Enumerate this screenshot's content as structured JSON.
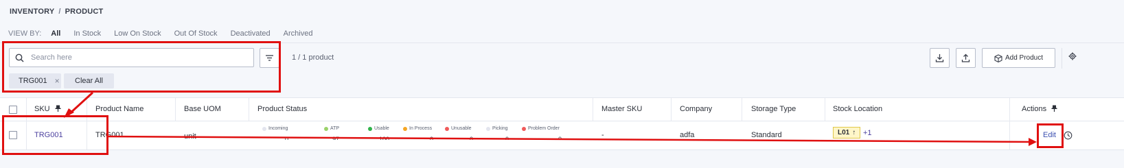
{
  "breadcrumb": {
    "parent": "INVENTORY",
    "separator": "/",
    "current": "PRODUCT"
  },
  "view_by": {
    "label": "VIEW BY:",
    "tabs": [
      "All",
      "In Stock",
      "Low On Stock",
      "Out Of Stock",
      "Deactivated",
      "Archived"
    ],
    "active": "All"
  },
  "search": {
    "placeholder": "Search here",
    "value": ""
  },
  "result_count": "1 / 1 product",
  "filters": {
    "chip": "TRG001",
    "chip_remove": "×",
    "clear_all": "Clear All"
  },
  "toolbar": {
    "add_product": "Add Product"
  },
  "table": {
    "columns": [
      "SKU",
      "Product Name",
      "Base UOM",
      "Product Status",
      "Master SKU",
      "Company",
      "Storage Type",
      "Stock Location",
      "Actions"
    ],
    "statuses": [
      {
        "label": "Incoming",
        "color": "#e3e5ee",
        "value": "0"
      },
      {
        "label": "ATP",
        "color": "#9bd26a",
        "value": "97"
      },
      {
        "label": "Usable",
        "color": "#2fb34a",
        "value": "100"
      },
      {
        "label": "In Process",
        "color": "#f5a623",
        "value": "0"
      },
      {
        "label": "Unusable",
        "color": "#f05a5a",
        "value": "0"
      },
      {
        "label": "Picking",
        "color": "#e3e5ee",
        "value": "0"
      },
      {
        "label": "Problem Order",
        "color": "#f05a5a",
        "value": "0"
      }
    ],
    "row": {
      "sku": "TRG001",
      "product_name": "TRG001",
      "base_uom": "unit",
      "master_sku": "-",
      "company": "adfa",
      "storage_type": "Standard",
      "stock_location": "L01",
      "stock_location_arrow": "↑",
      "stock_location_more": "+1",
      "edit": "Edit"
    }
  },
  "colors": {
    "highlight": "#e01010",
    "link": "#4b3f9e",
    "background": "#f5f7fb"
  }
}
